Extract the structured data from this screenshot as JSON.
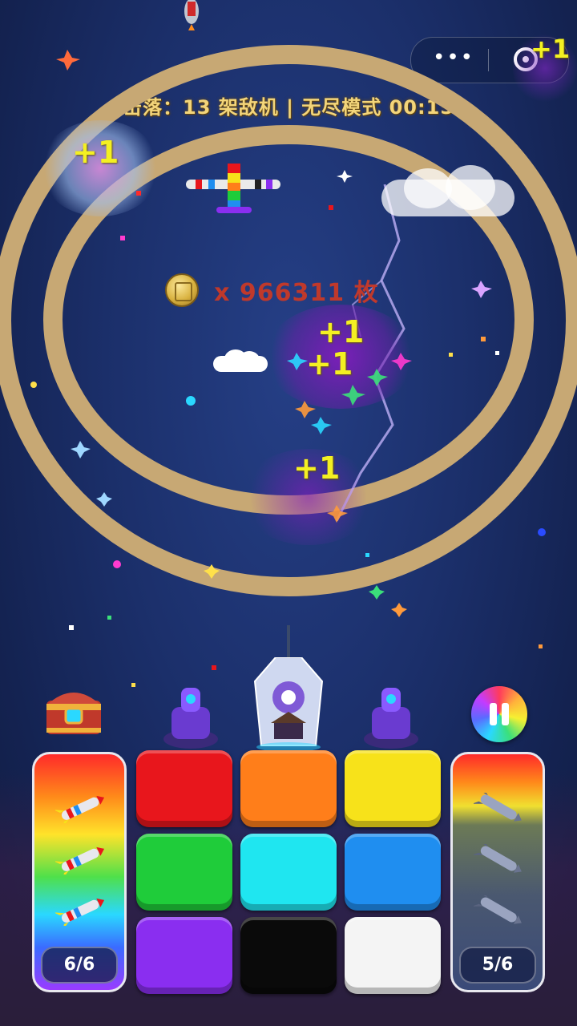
{
  "hud": {
    "score_line": "击落：13 架敌机 | 无尽模式 00:15",
    "coins_text": "x 966311 枚",
    "capsule_menu": "•••"
  },
  "effects": {
    "plus_one": "+1"
  },
  "left_magazine": {
    "counter": "6/6"
  },
  "right_magazine": {
    "counter": "5/6"
  },
  "color_tiles": [
    {
      "color": "#e8161c"
    },
    {
      "color": "#ff7e1a"
    },
    {
      "color": "#f7e21a"
    },
    {
      "color": "#1fcc3a"
    },
    {
      "color": "#1fe6f0"
    },
    {
      "color": "#1f8ef0"
    },
    {
      "color": "#8a2ef0"
    },
    {
      "color": "#0a0a0a"
    },
    {
      "color": "#f4f4f4"
    }
  ],
  "icons": {
    "chest": "treasure-chest-icon",
    "pause": "pause-icon",
    "coin": "coin-icon",
    "plane": "rainbow-plane-icon",
    "turret": "turret-icon",
    "crystal": "crystal-tower-icon",
    "missile": "missile-icon"
  },
  "colors": {
    "ring": "#c7a874",
    "score_text": "#f3d57a",
    "coin_text": "#c0392b",
    "plus_one": "#f4f022"
  }
}
